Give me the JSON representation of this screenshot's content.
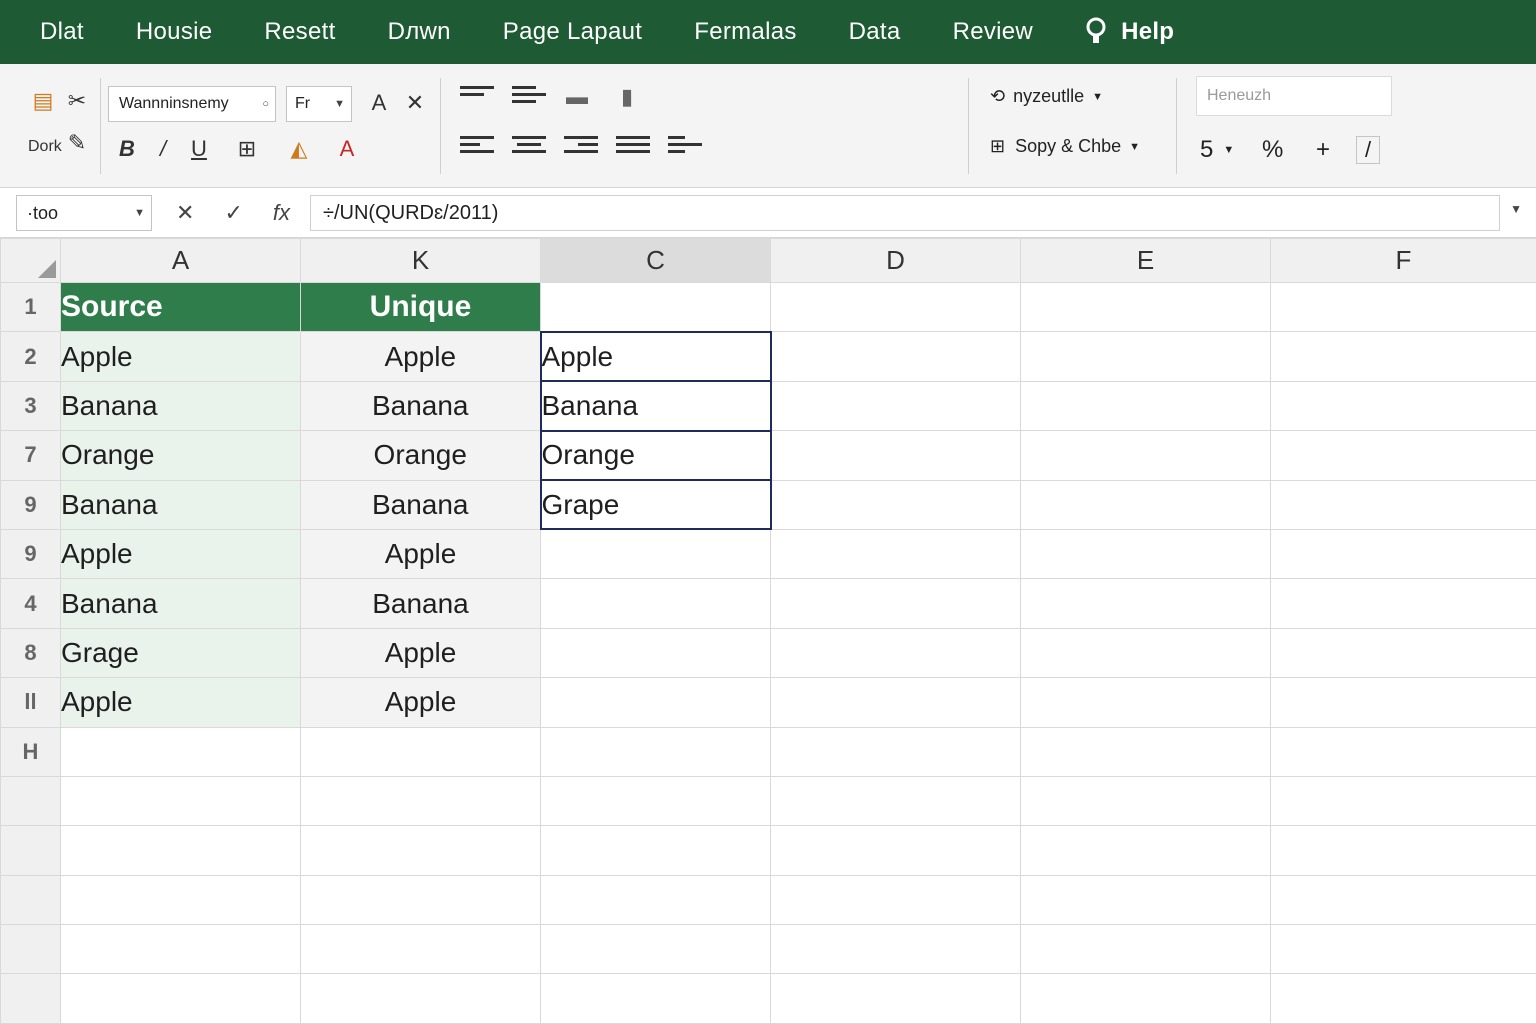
{
  "menu": {
    "tabs": [
      "Dlat",
      "Housie",
      "Resett",
      "Dлwn",
      "Page Lapaut",
      "Fermalas",
      "Data",
      "Review"
    ],
    "help_label": "Help"
  },
  "ribbon": {
    "dock_label": "Dork",
    "font_name": "Wannninsnemy",
    "font_size": "Fr",
    "conditional_label": "nyzeutlle",
    "copy_label": "Sopy & Chbe",
    "style_placeholder": "Heneuzh",
    "number_format": "5",
    "percent_label": "%",
    "plus_label": "+",
    "slash_label": "/"
  },
  "formula_bar": {
    "name_box": "·too",
    "formula": "÷/UN(QURDɛ/2011)"
  },
  "grid": {
    "columns": [
      "A",
      "K",
      "C",
      "D",
      "E",
      "F"
    ],
    "selected_column": "C",
    "rows": [
      {
        "num": "1",
        "a": "Source",
        "k": "Unique",
        "c": ""
      },
      {
        "num": "2",
        "a": "Apple",
        "k": "Apple",
        "c": "Apple"
      },
      {
        "num": "3",
        "a": "Banana",
        "k": "Banana",
        "c": "Banana"
      },
      {
        "num": "7",
        "a": "Orange",
        "k": "Orange",
        "c": "Orange"
      },
      {
        "num": "9",
        "a": "Banana",
        "k": "Banana",
        "c": "Grape"
      },
      {
        "num": "9",
        "a": "Apple",
        "k": "Apple",
        "c": ""
      },
      {
        "num": "4",
        "a": "Banana",
        "k": "Banana",
        "c": ""
      },
      {
        "num": "8",
        "a": "Grage",
        "k": "Apple",
        "c": ""
      },
      {
        "num": "ll",
        "a": "Apple",
        "k": "Apple",
        "c": ""
      },
      {
        "num": "H",
        "a": "",
        "k": "",
        "c": ""
      },
      {
        "num": "",
        "a": "",
        "k": "",
        "c": ""
      },
      {
        "num": "",
        "a": "",
        "k": "",
        "c": ""
      },
      {
        "num": "",
        "a": "",
        "k": "",
        "c": ""
      },
      {
        "num": "",
        "a": "",
        "k": "",
        "c": ""
      },
      {
        "num": "",
        "a": "",
        "k": "",
        "c": ""
      }
    ]
  },
  "colors": {
    "menu_bg": "#1e5a34",
    "header_green": "#2e7d4a",
    "source_fill": "#e9f3ec",
    "result_border": "#1f2a5e"
  },
  "icons": [
    "paste-icon",
    "cut-icon",
    "format-painter-icon",
    "bold-icon",
    "italic-icon",
    "underline-icon",
    "border-icon",
    "fill-color-icon",
    "font-color-icon",
    "grow-font-icon",
    "clear-format-icon",
    "align-top-icon",
    "align-middle-icon",
    "wrap-icon",
    "merge-icon",
    "align-left-icon",
    "align-center-icon",
    "align-right-icon",
    "indent-icon",
    "orientation-icon",
    "help-lightbulb-icon",
    "cancel-icon",
    "confirm-icon",
    "insert-function-icon"
  ]
}
